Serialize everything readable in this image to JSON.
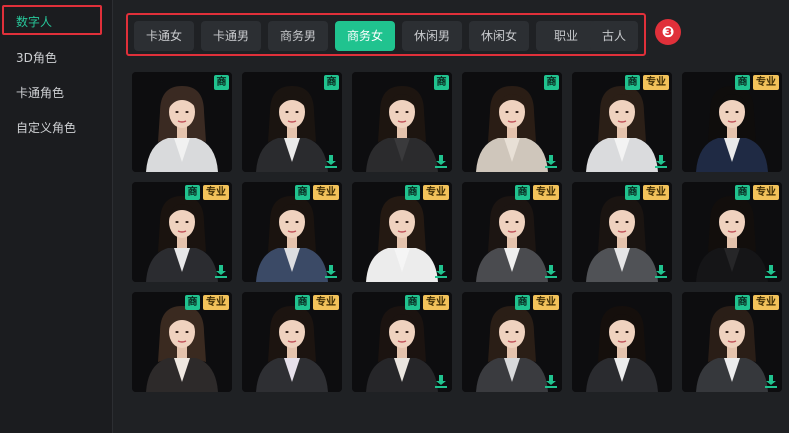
{
  "sidebar": {
    "items": [
      {
        "label": "数字人",
        "active": true
      },
      {
        "label": "3D角色",
        "active": false
      },
      {
        "label": "卡通角色",
        "active": false
      },
      {
        "label": "自定义角色",
        "active": false
      }
    ]
  },
  "tabs": {
    "items": [
      {
        "label": "卡通女",
        "active": false
      },
      {
        "label": "卡通男",
        "active": false
      },
      {
        "label": "商务男",
        "active": false
      },
      {
        "label": "商务女",
        "active": true
      },
      {
        "label": "休闲男",
        "active": false
      },
      {
        "label": "休闲女",
        "active": false
      },
      {
        "label": "职业",
        "active": false
      },
      {
        "label": "古人",
        "active": false
      }
    ],
    "step_number": "❸"
  },
  "badges": {
    "shang": "商",
    "zhuanye": "专业"
  },
  "colors": {
    "accent": "#20c38f",
    "highlight": "#e0303a",
    "pro": "#f2c25a"
  },
  "avatars": [
    {
      "shang": true,
      "pro": false,
      "download": false,
      "outfit": "#d9dadc",
      "inner": "#f1f1f1",
      "hair": "#3a2a22",
      "bg": "#0d0d0f"
    },
    {
      "shang": true,
      "pro": false,
      "download": true,
      "outfit": "#2a2b2e",
      "inner": "#eaeaea",
      "hair": "#1a1410",
      "bg": "#0d0d0f"
    },
    {
      "shang": true,
      "pro": false,
      "download": true,
      "outfit": "#2b2b2d",
      "inner": "#3a3a3c",
      "hair": "#1d1510",
      "bg": "#0d0d0f"
    },
    {
      "shang": true,
      "pro": false,
      "download": true,
      "outfit": "#cfc6bb",
      "inner": "#e8e0d6",
      "hair": "#2a1d15",
      "bg": "#0d0d0f"
    },
    {
      "shang": true,
      "pro": true,
      "download": true,
      "outfit": "#dadbdd",
      "inner": "#f3f3f3",
      "hair": "#2b1f17",
      "bg": "#0d0d0f"
    },
    {
      "shang": true,
      "pro": true,
      "download": false,
      "outfit": "#1f2a44",
      "inner": "#e9e9ea",
      "hair": "#0f0d0c",
      "bg": "#0d0d0f"
    },
    {
      "shang": true,
      "pro": true,
      "download": true,
      "outfit": "#2b2c30",
      "inner": "#e7e7e8",
      "hair": "#1a130f",
      "bg": "#0d0d0f"
    },
    {
      "shang": true,
      "pro": true,
      "download": true,
      "outfit": "#3b4a66",
      "inner": "#dcdde0",
      "hair": "#1a130f",
      "bg": "#0d0d0f"
    },
    {
      "shang": true,
      "pro": true,
      "download": true,
      "outfit": "#ececec",
      "inner": "#f5f5f5",
      "hair": "#241912",
      "bg": "#0d0d0f"
    },
    {
      "shang": true,
      "pro": true,
      "download": true,
      "outfit": "#4a4b4f",
      "inner": "#efefef",
      "hair": "#1c1512",
      "bg": "#0d0d0f"
    },
    {
      "shang": true,
      "pro": true,
      "download": true,
      "outfit": "#505256",
      "inner": "#e5e5e6",
      "hair": "#1a1411",
      "bg": "#0d0d0f"
    },
    {
      "shang": true,
      "pro": true,
      "download": true,
      "outfit": "#151517",
      "inner": "#262628",
      "hair": "#120e0c",
      "bg": "#0d0d0f"
    },
    {
      "shang": true,
      "pro": true,
      "download": false,
      "outfit": "#2d2a2a",
      "inner": "#efe8e1",
      "hair": "#3a2a20",
      "bg": "#0d0d0f"
    },
    {
      "shang": true,
      "pro": true,
      "download": false,
      "outfit": "#2e2f33",
      "inner": "#e6e0ea",
      "hair": "#1c1410",
      "bg": "#0d0d0f"
    },
    {
      "shang": true,
      "pro": true,
      "download": true,
      "outfit": "#262629",
      "inner": "#eae5df",
      "hair": "#1b1310",
      "bg": "#0d0d0f"
    },
    {
      "shang": true,
      "pro": true,
      "download": true,
      "outfit": "#3a3b3f",
      "inner": "#d8d9db",
      "hair": "#2a1e16",
      "bg": "#0d0d0f"
    },
    {
      "shang": false,
      "pro": false,
      "download": false,
      "outfit": "#2a2b2f",
      "inner": "#ececec",
      "hair": "#150f0c",
      "bg": "#0d0d0f"
    },
    {
      "shang": true,
      "pro": true,
      "download": true,
      "outfit": "#36383c",
      "inner": "#ececed",
      "hair": "#2a1e17",
      "bg": "#0d0d0f"
    }
  ]
}
